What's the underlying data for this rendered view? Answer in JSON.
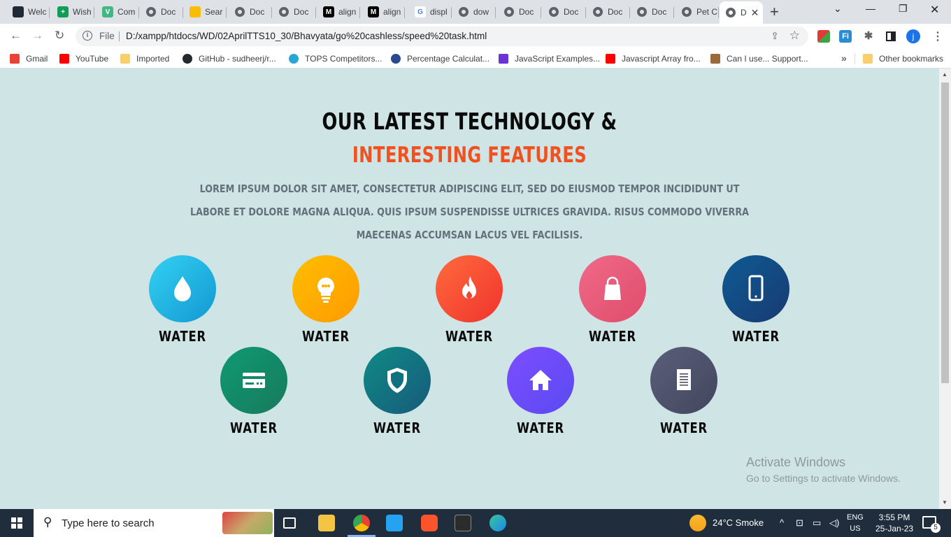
{
  "browser": {
    "tabs": [
      {
        "label": "Welc",
        "icon": "dark-app-icon",
        "color": "#1e2a36"
      },
      {
        "label": "Wish",
        "icon": "sheets-icon",
        "color": "#0f9d58"
      },
      {
        "label": "Com",
        "icon": "vue-icon",
        "color": "#41b883"
      },
      {
        "label": "Doc",
        "icon": "globe-icon",
        "color": "#5f6368"
      },
      {
        "label": "Sear",
        "icon": "drive-icon",
        "color": "#fbbc04"
      },
      {
        "label": "Doc",
        "icon": "globe-icon",
        "color": "#5f6368"
      },
      {
        "label": "Doc",
        "icon": "globe-icon",
        "color": "#5f6368"
      },
      {
        "label": "align",
        "icon": "m-icon",
        "color": "#000000"
      },
      {
        "label": "align",
        "icon": "m-icon",
        "color": "#000000"
      },
      {
        "label": "displ",
        "icon": "google-icon",
        "color": "#4285f4"
      },
      {
        "label": "dow",
        "icon": "globe-icon",
        "color": "#5f6368"
      },
      {
        "label": "Doc",
        "icon": "globe-icon",
        "color": "#5f6368"
      },
      {
        "label": "Doc",
        "icon": "globe-icon",
        "color": "#5f6368"
      },
      {
        "label": "Doc",
        "icon": "globe-icon",
        "color": "#5f6368"
      },
      {
        "label": "Doc",
        "icon": "globe-icon",
        "color": "#5f6368"
      },
      {
        "label": "Pet C",
        "icon": "globe-icon",
        "color": "#5f6368"
      },
      {
        "label": "D",
        "icon": "globe-icon",
        "color": "#5f6368",
        "active": true
      }
    ],
    "new_tab": "+",
    "address": {
      "scheme_label": "File",
      "url": "D:/xampp/htdocs/WD/02AprilTTS10_30/Bhavyata/go%20cashless/speed%20task.html"
    },
    "avatar_letter": "j",
    "bookmarks": [
      {
        "label": "Gmail",
        "icon": "gmail-icon",
        "color": "#ea4335"
      },
      {
        "label": "YouTube",
        "icon": "youtube-icon",
        "color": "#ff0000"
      },
      {
        "label": "Imported",
        "icon": "folder-icon",
        "color": "#f7cf6b"
      },
      {
        "label": "GitHub - sudheerj/r...",
        "icon": "github-icon",
        "color": "#24292e"
      },
      {
        "label": "TOPS Competitors...",
        "icon": "tops-icon",
        "color": "#2aa6d6"
      },
      {
        "label": "Percentage Calculat...",
        "icon": "calculator-icon",
        "color": "#2b4a8b"
      },
      {
        "label": "JavaScript Examples...",
        "icon": "programiz-icon",
        "color": "#6b33d6"
      },
      {
        "label": "Javascript Array fro...",
        "icon": "youtube-icon",
        "color": "#ff0000"
      },
      {
        "label": "Can I use... Support...",
        "icon": "caniuse-icon",
        "color": "#9c6a3a"
      }
    ],
    "bookmarks_more": "»",
    "other_bookmarks": "Other bookmarks"
  },
  "page": {
    "heading": "OUR LATEST TECHNOLOGY &",
    "subheading": "INTERESTING FEATURES",
    "description": "LOREM IPSUM DOLOR SIT AMET, CONSECTETUR ADIPISCING ELIT, SED DO EIUSMOD TEMPOR INCIDIDUNT UT LABORE ET DOLORE MAGNA ALIQUA. QUIS IPSUM SUSPENDISSE ULTRICES GRAVIDA. RISUS COMMODO VIVERRA MAECENAS ACCUMSAN LACUS VEL FACILISIS.",
    "features": [
      {
        "label": "WATER",
        "icon": "water-drop-icon",
        "gradient": [
          "#33d1f2",
          "#1398d3"
        ]
      },
      {
        "label": "WATER",
        "icon": "lightbulb-icon",
        "gradient": [
          "#ffbf00",
          "#ff9a00"
        ]
      },
      {
        "label": "WATER",
        "icon": "flame-icon",
        "gradient": [
          "#ff6b3d",
          "#f0332d"
        ]
      },
      {
        "label": "WATER",
        "icon": "shopping-bag-icon",
        "gradient": [
          "#f06a8a",
          "#e04c6a"
        ]
      },
      {
        "label": "WATER",
        "icon": "mobile-phone-icon",
        "gradient": [
          "#0f5a94",
          "#173b70"
        ]
      },
      {
        "label": "WATER",
        "icon": "credit-card-icon",
        "gradient": [
          "#0f9a72",
          "#177a5c"
        ]
      },
      {
        "label": "WATER",
        "icon": "shield-icon",
        "gradient": [
          "#0f8b85",
          "#175a7a"
        ]
      },
      {
        "label": "WATER",
        "icon": "home-icon",
        "gradient": [
          "#7d4cff",
          "#5a4bf0"
        ]
      },
      {
        "label": "WATER",
        "icon": "document-icon",
        "gradient": [
          "#5a5f7a",
          "#42465e"
        ]
      }
    ],
    "activate_title": "Activate Windows",
    "activate_sub": "Go to Settings to activate Windows."
  },
  "taskbar": {
    "search_placeholder": "Type here to search",
    "weather": "24°C  Smoke",
    "lang_top": "ENG",
    "lang_bottom": "US",
    "time": "3:55 PM",
    "date": "25-Jan-23",
    "notification_count": "5"
  }
}
